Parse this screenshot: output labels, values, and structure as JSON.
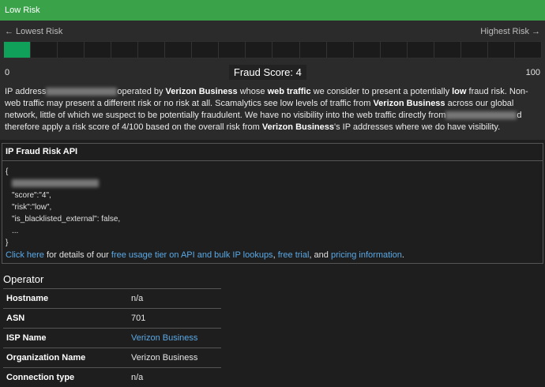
{
  "header": {
    "title": "Low Risk"
  },
  "scale": {
    "left_label": "← Lowest Risk",
    "right_label": "Highest Risk →",
    "min": "0",
    "max": "100",
    "segments": 20,
    "filled": 1
  },
  "score": {
    "label": "Fraud Score: 4"
  },
  "description": {
    "t1": "IP address",
    "t2": "operated by ",
    "b1": "Verizon Business",
    "t3": " whose ",
    "b2": "web traffic",
    "t4": " we consider to present a potentially ",
    "b3": "low",
    "t5": " fraud risk. Non-web traffic may present a different risk or no risk at all. Scamalytics see low levels of traffic from ",
    "b4": "Verizon Business",
    "t6": " across our global network, little of which we suspect to be potentially fraudulent. We have no visibility into the web traffic directly from",
    "t7": "d therefore apply a risk score of 4/100 based on the overall risk from ",
    "b5": "Verizon Business",
    "t8": "'s IP addresses where we do have visibility."
  },
  "api": {
    "title": "IP Fraud Risk API",
    "open": "{",
    "line_score": "\"score\":\"4\",",
    "line_risk": "\"risk\":\"low\",",
    "line_black": "\"is_blacklisted_external\": false,",
    "ellipsis": "...",
    "close": "}",
    "link_click": "Click here",
    "text_details": " for details of our ",
    "link_free": "free usage tier on API and bulk IP lookups",
    "sep": ", ",
    "link_trial": "free trial",
    "text_and": ", and ",
    "link_pricing": "pricing information",
    "dot": "."
  },
  "operator": {
    "title": "Operator",
    "rows": [
      {
        "key": "Hostname",
        "value": "n/a"
      },
      {
        "key": "ASN",
        "value": "701"
      },
      {
        "key": "ISP Name",
        "value": "Verizon Business"
      },
      {
        "key": "Organization Name",
        "value": "Verizon Business"
      },
      {
        "key": "Connection type",
        "value": "n/a"
      }
    ]
  }
}
